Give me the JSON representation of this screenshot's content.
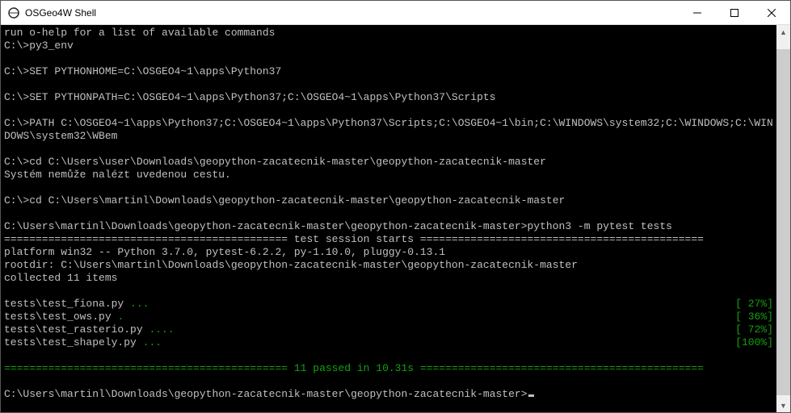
{
  "window": {
    "title": "OSGeo4W Shell"
  },
  "console": {
    "lines": [
      {
        "text": "run o-help for a list of available commands",
        "cls": ""
      },
      {
        "text": "C:\\>py3_env",
        "cls": ""
      },
      {
        "text": "",
        "cls": ""
      },
      {
        "text": "C:\\>SET PYTHONHOME=C:\\OSGEO4~1\\apps\\Python37",
        "cls": ""
      },
      {
        "text": "",
        "cls": ""
      },
      {
        "text": "C:\\>SET PYTHONPATH=C:\\OSGEO4~1\\apps\\Python37;C:\\OSGEO4~1\\apps\\Python37\\Scripts",
        "cls": ""
      },
      {
        "text": "",
        "cls": ""
      },
      {
        "text": "C:\\>PATH C:\\OSGEO4~1\\apps\\Python37;C:\\OSGEO4~1\\apps\\Python37\\Scripts;C:\\OSGEO4~1\\bin;C:\\WINDOWS\\system32;C:\\WINDOWS;C:\\WINDOWS\\system32\\WBem",
        "cls": ""
      },
      {
        "text": "",
        "cls": ""
      },
      {
        "text": "C:\\>cd C:\\Users\\user\\Downloads\\geopython-zacatecnik-master\\geopython-zacatecnik-master",
        "cls": ""
      },
      {
        "text": "Systém nemůže nalézt uvedenou cestu.",
        "cls": ""
      },
      {
        "text": "",
        "cls": ""
      },
      {
        "text": "C:\\>cd C:\\Users\\martinl\\Downloads\\geopython-zacatecnik-master\\geopython-zacatecnik-master",
        "cls": ""
      },
      {
        "text": "",
        "cls": ""
      },
      {
        "text": "C:\\Users\\martinl\\Downloads\\geopython-zacatecnik-master\\geopython-zacatecnik-master>python3 -m pytest tests",
        "cls": ""
      }
    ],
    "session_header": "============================================= test session starts =============================================",
    "platform_line": "platform win32 -- Python 3.7.0, pytest-6.2.2, py-1.10.0, pluggy-0.13.1",
    "rootdir_line": "rootdir: C:\\Users\\martinl\\Downloads\\geopython-zacatecnik-master\\geopython-zacatecnik-master",
    "collected_line": "collected 11 items",
    "tests": [
      {
        "left": "tests\\test_fiona.py ",
        "dots": "...",
        "right": "[ 27%]"
      },
      {
        "left": "tests\\test_ows.py ",
        "dots": ".",
        "right": "[ 36%]"
      },
      {
        "left": "tests\\test_rasterio.py ",
        "dots": "....",
        "right": "[ 72%]"
      },
      {
        "left": "tests\\test_shapely.py ",
        "dots": "...",
        "right": "[100%]"
      }
    ],
    "summary_line": "============================================= 11 passed in 10.31s =============================================",
    "prompt": "C:\\Users\\martinl\\Downloads\\geopython-zacatecnik-master\\geopython-zacatecnik-master>"
  },
  "scrollbar": {
    "up": "▲",
    "down": "▼",
    "thumb_top_pct": 3,
    "thumb_height_pct": 96
  }
}
